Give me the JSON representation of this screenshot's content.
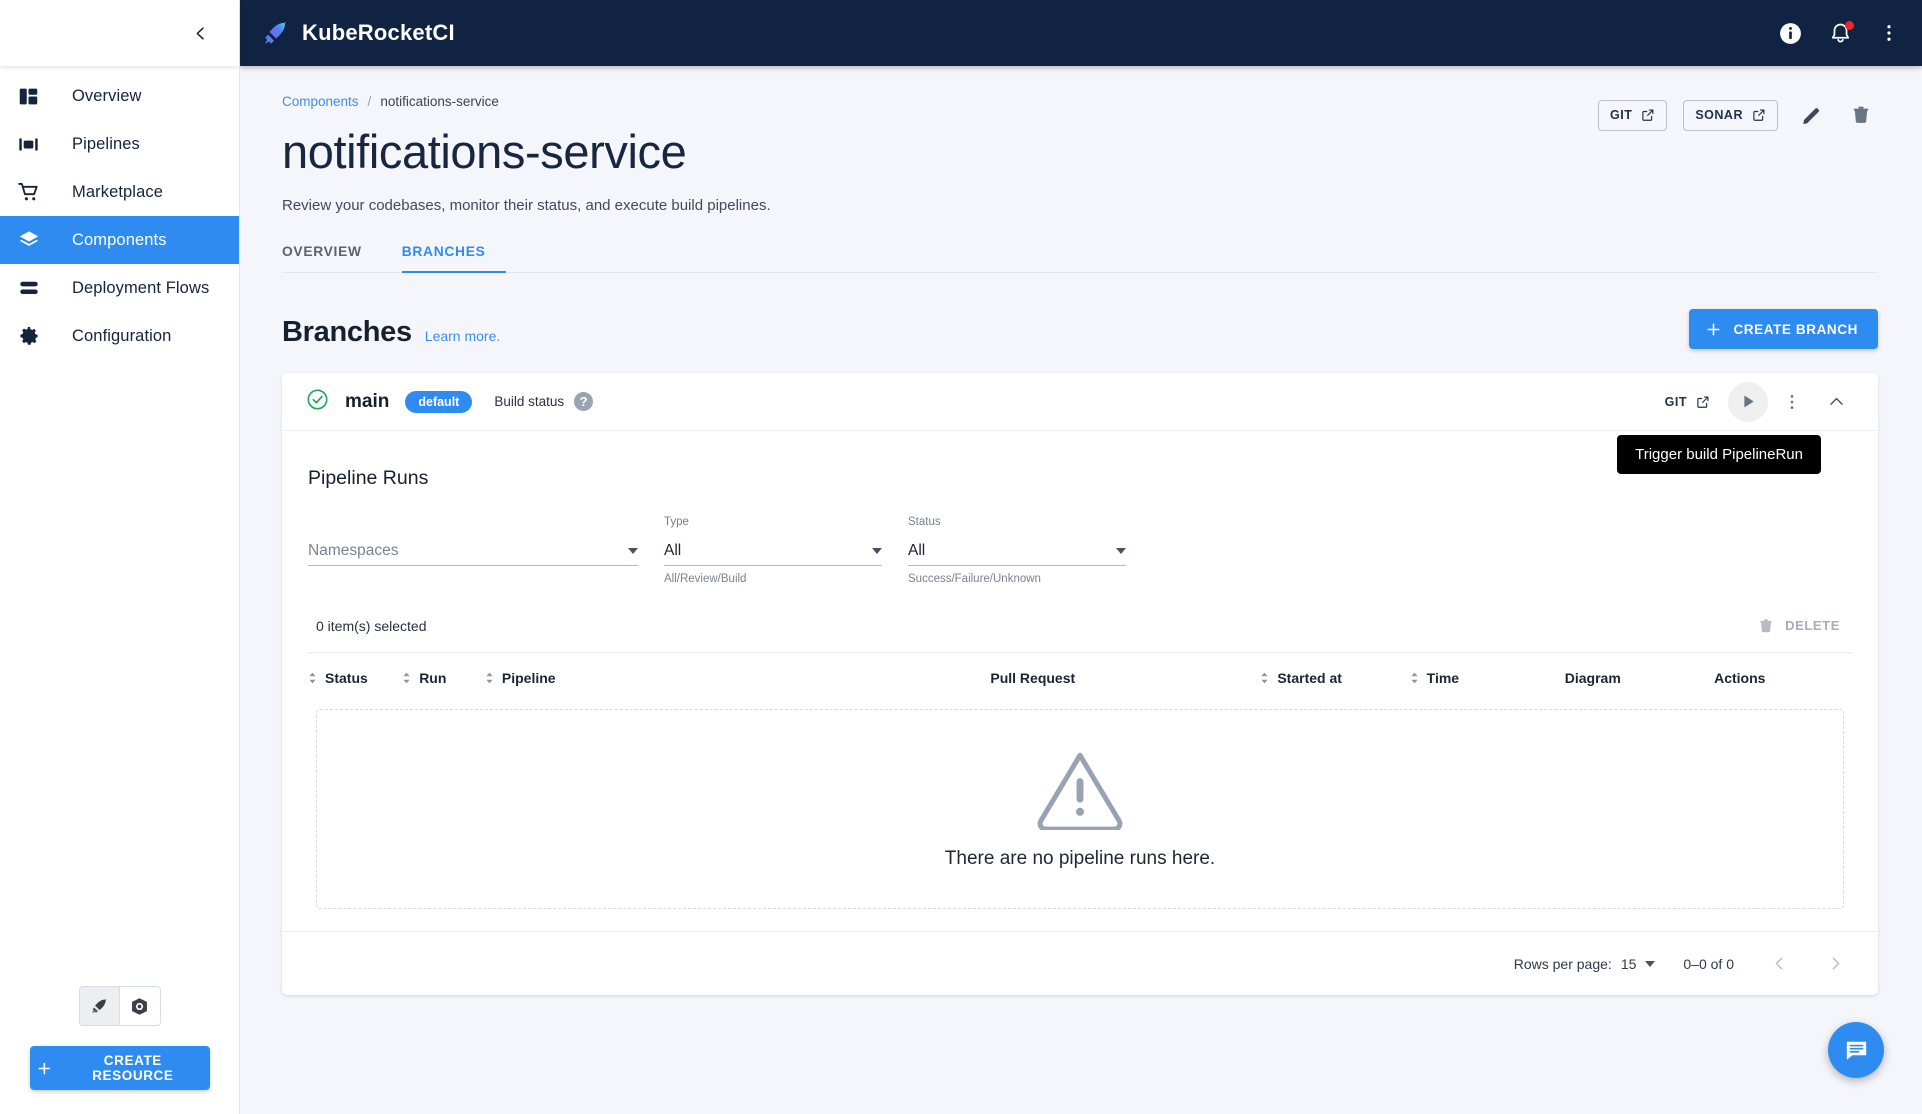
{
  "brand": {
    "name": "KubeRocketCI",
    "logo_icon": "rocket-logo-icon"
  },
  "topbar": {
    "info_icon": "info-icon",
    "notifications_icon": "bell-icon",
    "overflow_icon": "more-vertical-icon"
  },
  "sidebar": {
    "collapse_icon": "chevron-left-icon",
    "items": [
      {
        "label": "Overview",
        "icon": "dashboard-icon",
        "active": false
      },
      {
        "label": "Pipelines",
        "icon": "pipelines-icon",
        "active": false
      },
      {
        "label": "Marketplace",
        "icon": "cart-icon",
        "active": false
      },
      {
        "label": "Components",
        "icon": "layers-icon",
        "active": true
      },
      {
        "label": "Deployment Flows",
        "icon": "flows-icon",
        "active": false
      },
      {
        "label": "Configuration",
        "icon": "gear-icon",
        "active": false
      }
    ],
    "cluster_toggle": [
      {
        "icon": "rocket-icon",
        "selected": true
      },
      {
        "icon": "kubernetes-icon",
        "selected": false
      }
    ],
    "create_resource_label": "CREATE RESOURCE"
  },
  "breadcrumb": {
    "parent": "Components",
    "separator": "/",
    "current": "notifications-service"
  },
  "page": {
    "title": "notifications-service",
    "subtitle": "Review your codebases, monitor their status, and execute build pipelines."
  },
  "header_actions": {
    "git_label": "GIT",
    "sonar_label": "SONAR",
    "edit_icon": "pencil-icon",
    "delete_icon": "trash-icon",
    "external_icon": "external-link-icon"
  },
  "tabs": [
    {
      "label": "OVERVIEW",
      "active": false
    },
    {
      "label": "BRANCHES",
      "active": true
    }
  ],
  "branches_section": {
    "title": "Branches",
    "learn_more": "Learn more.",
    "create_branch_label": "CREATE BRANCH",
    "plus_icon": "plus-icon"
  },
  "branch": {
    "status_icon": "check-circle-icon",
    "status_color": "#23a55a",
    "name": "main",
    "badge": "default",
    "build_status_label": "Build status",
    "help_icon": "question-mark-icon",
    "git_label": "GIT",
    "play_icon": "play-icon",
    "menu_icon": "more-vertical-icon",
    "collapse_icon": "chevron-up-icon",
    "tooltip": "Trigger build PipelineRun"
  },
  "pipeline_runs": {
    "title": "Pipeline Runs",
    "filters": [
      {
        "name": "namespaces",
        "label": "",
        "value": "",
        "placeholder": "Namespaces",
        "help": ""
      },
      {
        "name": "type",
        "label": "Type",
        "value": "All",
        "placeholder": "",
        "help": "All/Review/Build"
      },
      {
        "name": "status",
        "label": "Status",
        "value": "All",
        "placeholder": "",
        "help": "Success/Failure/Unknown"
      }
    ],
    "selection_text": "0 item(s) selected",
    "delete_label": "DELETE",
    "delete_icon": "trash-icon",
    "columns": [
      {
        "label": "Status",
        "sortable": true
      },
      {
        "label": "Run",
        "sortable": true
      },
      {
        "label": "Pipeline",
        "sortable": true
      },
      {
        "label": "Pull Request",
        "sortable": false
      },
      {
        "label": "Started at",
        "sortable": true
      },
      {
        "label": "Time",
        "sortable": true
      },
      {
        "label": "Diagram",
        "sortable": false
      },
      {
        "label": "Actions",
        "sortable": false
      }
    ],
    "rows": [],
    "empty_state": {
      "icon": "warning-triangle-icon",
      "text": "There are no pipeline runs here."
    },
    "pagination": {
      "rows_per_page_label": "Rows per page:",
      "rows_per_page_value": "15",
      "range_text": "0–0 of 0",
      "prev_icon": "chevron-left-icon",
      "next_icon": "chevron-right-icon"
    }
  },
  "fab": {
    "icon": "chat-icon"
  },
  "colors": {
    "accent": "#2e8bf0",
    "topbar_bg": "#102342",
    "page_bg": "#f4f6fb",
    "success": "#23a55a",
    "danger": "#ef2626"
  }
}
